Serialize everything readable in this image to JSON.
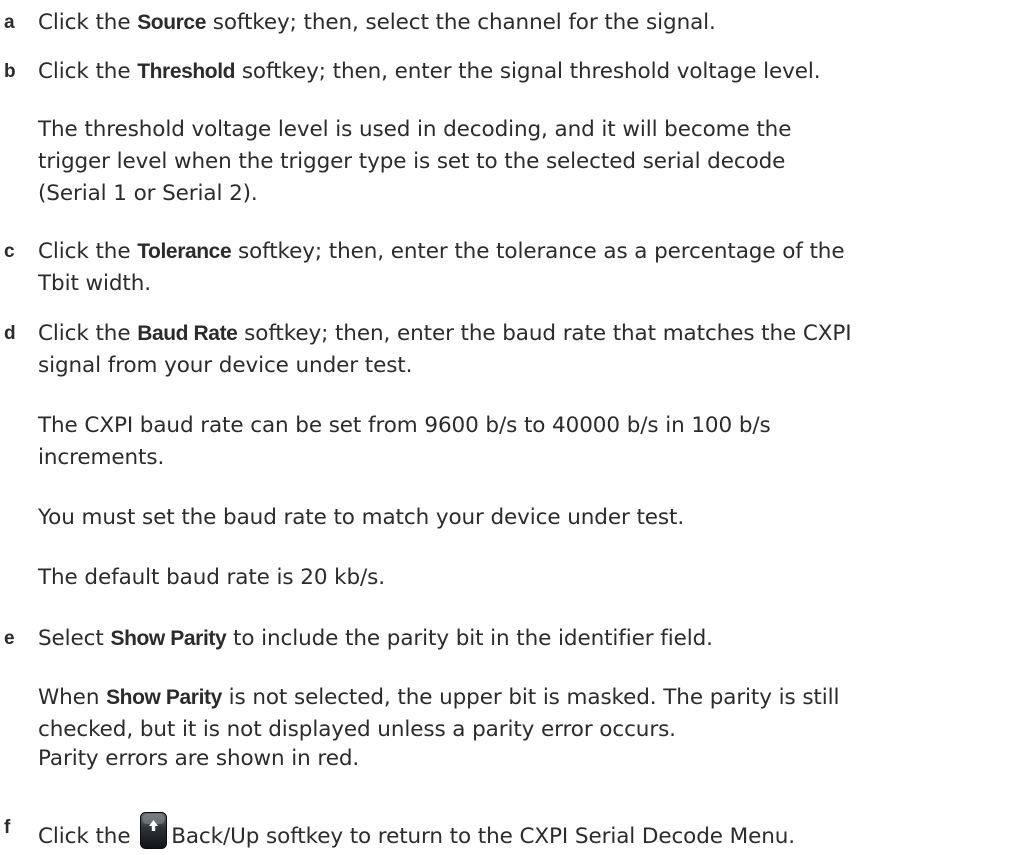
{
  "steps": {
    "a": {
      "letter": "a",
      "pre": "Click the ",
      "key": "Source",
      "post": " softkey; then, select the channel for the signal."
    },
    "b": {
      "letter": "b",
      "pre": "Click the ",
      "key": "Threshold",
      "post": " softkey; then, enter the signal threshold voltage level.",
      "note_line1": "The threshold voltage level is used in decoding, and it will become the",
      "note_line2": "trigger level when the trigger type is set to the selected serial decode",
      "note_line3": "(Serial 1 or Serial 2)."
    },
    "c": {
      "letter": "c",
      "pre": "Click the ",
      "key": "Tolerance",
      "post": " softkey; then, enter the tolerance as a percentage of the",
      "line2": "Tbit width."
    },
    "d": {
      "letter": "d",
      "pre": "Click the ",
      "key": "Baud Rate",
      "post": " softkey; then, enter the baud rate that matches the CXPI",
      "line2": "signal from your device under test.",
      "note1_line1": "The CXPI baud rate can be set from 9600 b/s to 40000 b/s in 100 b/s",
      "note1_line2": "increments.",
      "note2": "You must set the baud rate to match your device under test.",
      "note3": "The default baud rate is 20 kb/s."
    },
    "e": {
      "letter": "e",
      "pre": "Select ",
      "key": "Show Parity",
      "post": " to include the parity bit in the identifier field.",
      "note1_pre": "When ",
      "note1_key": "Show Parity",
      "note1_post": " is not selected, the upper bit is masked. The parity is still",
      "note1_line2": "checked, but it is not displayed unless a parity error occurs.",
      "note2": "Parity errors are shown in red."
    },
    "f": {
      "letter": "f",
      "pre": "Click the ",
      "icon": "back-up-softkey-icon",
      "post": "Back/Up softkey to return to the CXPI Serial Decode Menu."
    }
  }
}
